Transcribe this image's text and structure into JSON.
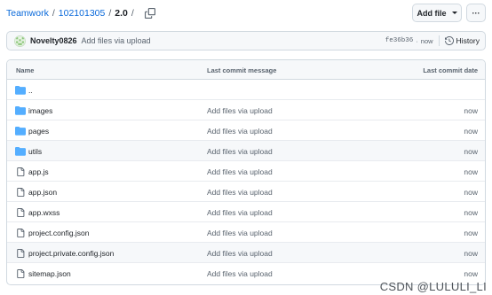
{
  "breadcrumb": {
    "repo": "Teamwork",
    "separator": "/",
    "folder": "102101305",
    "current": "2.0",
    "trailing_separator": "/"
  },
  "actions": {
    "add_file_label": "Add file",
    "more_label": "···"
  },
  "commit": {
    "author": "Novelty0826",
    "message": "Add files via upload",
    "sha": "fe36b36",
    "separator": "·",
    "time": "now",
    "history_label": "History"
  },
  "table": {
    "headers": {
      "name": "Name",
      "message": "Last commit message",
      "date": "Last commit date"
    },
    "parent": "..",
    "rows": [
      {
        "type": "folder",
        "name": "images",
        "message": "Add files via upload",
        "date": "now"
      },
      {
        "type": "folder",
        "name": "pages",
        "message": "Add files via upload",
        "date": "now"
      },
      {
        "type": "folder",
        "name": "utils",
        "message": "Add files via upload",
        "date": "now"
      },
      {
        "type": "file",
        "name": "app.js",
        "message": "Add files via upload",
        "date": "now"
      },
      {
        "type": "file",
        "name": "app.json",
        "message": "Add files via upload",
        "date": "now"
      },
      {
        "type": "file",
        "name": "app.wxss",
        "message": "Add files via upload",
        "date": "now"
      },
      {
        "type": "file",
        "name": "project.config.json",
        "message": "Add files via upload",
        "date": "now"
      },
      {
        "type": "file",
        "name": "project.private.config.json",
        "message": "Add files via upload",
        "date": "now"
      },
      {
        "type": "file",
        "name": "sitemap.json",
        "message": "Add files via upload",
        "date": "now"
      }
    ]
  },
  "watermark": "CSDN @LULULI_LI",
  "colors": {
    "link": "#0969da",
    "folder_icon": "#54aeff",
    "file_icon": "#59636e",
    "muted_text": "#59636e",
    "border": "#d1d9e0",
    "header_bg": "#f6f8fa"
  },
  "icons": {
    "copy": "copy-icon",
    "history": "history-icon",
    "folder": "folder-icon",
    "file": "file-icon",
    "dropdown": "caret-down-icon",
    "kebab": "kebab-horizontal-icon"
  }
}
